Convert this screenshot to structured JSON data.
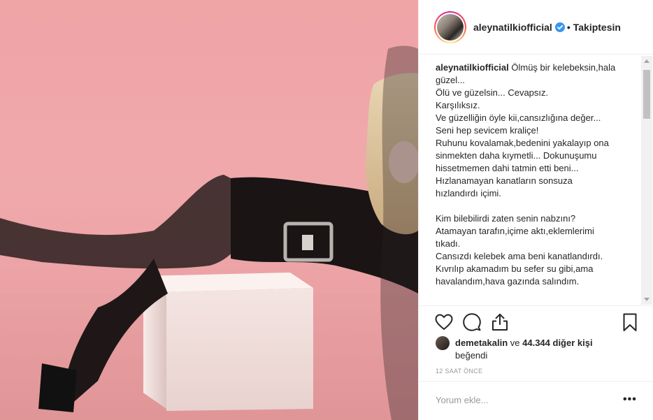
{
  "post": {
    "username": "aleynatilkiofficial",
    "verified_icon": "verified-badge-icon",
    "separator": "•",
    "follow_status": "Takiptesin",
    "caption_username": "aleynatilkiofficial",
    "caption_text": " Ölmüş bir kelebeksin,hala\ngüzel...\nÖlü ve güzelsin... Cevapsız.\nKarşılıksız.\nVe güzelliğin öyle kii,cansızlığına değer...\nSeni hep sevicem kraliçe!\nRuhunu kovalamak,bedenini yakalayıp ona\nsinmekten daha kıymetli... Dokunuşumu\nhissetmemen dahi tatmin etti beni...\nHızlanamayan kanatların sonsuza\nhızlandırdı içimi.\n\nKim bilebilirdi zaten senin nabzını?\nAtamayan tarafın,içime aktı,eklemlerimi\ntıkadı.\nCansızdı kelebek ama beni kanatlandırdı.\nKıvrılıp akamadım bu sefer su gibi,ama\nhavalandım,hava gazında salındım.",
    "likes_user": "demetakalin",
    "likes_connector": " ve ",
    "likes_count": "44.344 diğer kişi",
    "likes_suffix": "beğendi",
    "timestamp": "12 SAAT ÖNCE",
    "comment_placeholder": "Yorum ekle...",
    "more_options": "•••"
  },
  "icons": {
    "like": "heart-icon",
    "comment": "comment-icon",
    "share": "share-icon",
    "save": "bookmark-icon"
  },
  "colors": {
    "background_pink": "#efa4a6",
    "verified_blue": "#3897f0",
    "text": "#262626",
    "muted": "#999999"
  }
}
